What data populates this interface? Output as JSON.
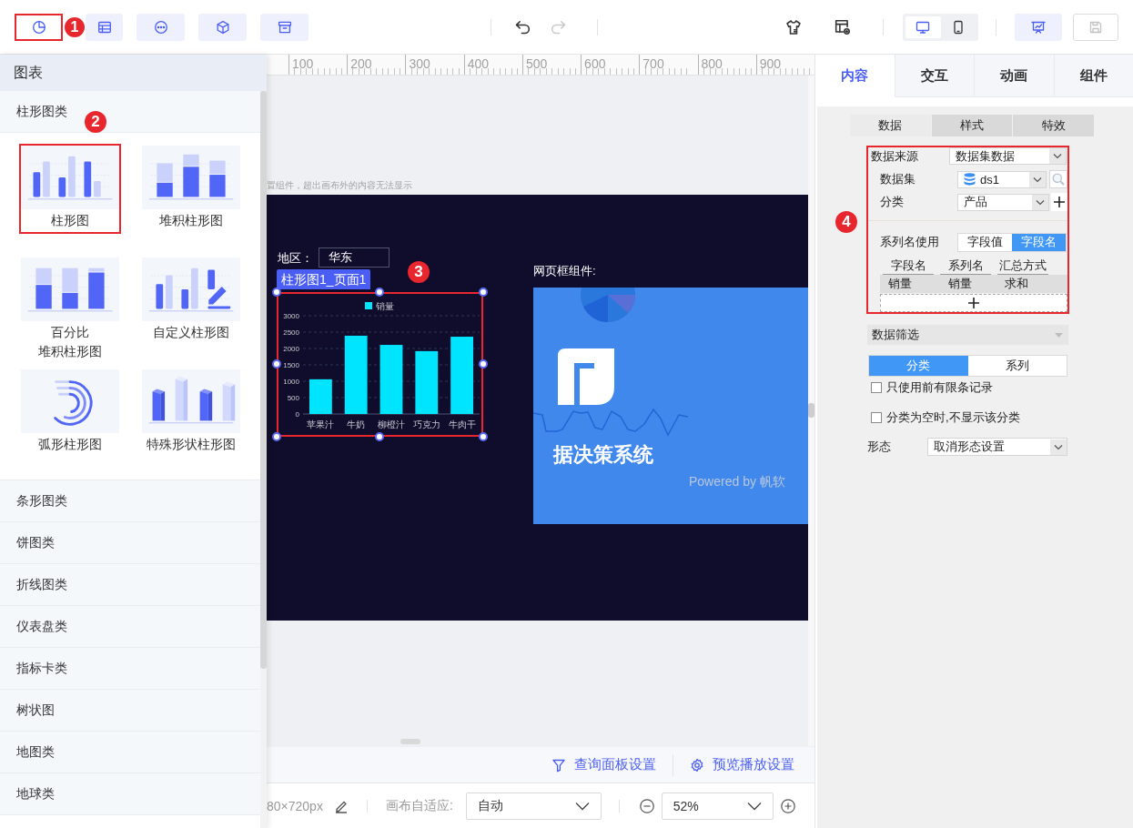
{
  "toolbar": {
    "left_buttons": [
      {
        "kind": "chart",
        "highlighted": true,
        "callout": "1"
      },
      {
        "kind": "table",
        "highlighted": false
      },
      {
        "kind": "more",
        "highlighted": false
      },
      {
        "kind": "cube",
        "highlighted": false
      },
      {
        "kind": "archive",
        "highlighted": false
      }
    ],
    "history": [
      {
        "kind": "undo",
        "disabled": false
      },
      {
        "kind": "redo",
        "disabled": true
      }
    ],
    "tools": [
      {
        "kind": "theme"
      },
      {
        "kind": "template"
      }
    ],
    "devices": [
      {
        "kind": "desktop",
        "selected": true
      },
      {
        "kind": "mobile",
        "selected": false
      }
    ],
    "actions": [
      {
        "kind": "present",
        "disabled": false
      },
      {
        "kind": "save",
        "disabled": true
      }
    ]
  },
  "component_panel": {
    "title": "图表",
    "groups": [
      {
        "label": "柱形图类",
        "items": [
          {
            "kind": "bar",
            "label_lines": [
              "柱形图"
            ],
            "highlighted": true,
            "callout": "2"
          },
          {
            "kind": "stacked",
            "label_lines": [
              "堆积柱形图"
            ],
            "highlighted": false
          },
          {
            "kind": "percent",
            "label_lines": [
              "百分比",
              "堆积柱形图"
            ],
            "highlighted": false
          },
          {
            "kind": "custom",
            "label_lines": [
              "自定义柱形图"
            ],
            "highlighted": false
          },
          {
            "kind": "arc",
            "label_lines": [
              "弧形柱形图"
            ],
            "highlighted": false
          },
          {
            "kind": "shaped",
            "label_lines": [
              "特殊形状柱形图"
            ],
            "highlighted": false
          }
        ]
      },
      {
        "label": "条形图类"
      },
      {
        "label": "饼图类"
      },
      {
        "label": "折线图类"
      },
      {
        "label": "仪表盘类"
      },
      {
        "label": "指标卡类"
      },
      {
        "label": "树状图"
      },
      {
        "label": "地图类"
      },
      {
        "label": "地球类"
      }
    ]
  },
  "canvas": {
    "ruler": [
      "100",
      "200",
      "300",
      "400",
      "500",
      "600",
      "700",
      "800",
      "900"
    ],
    "hint": "置组件，超出画布外的内容无法显示",
    "filter": {
      "label": "地区：",
      "value": "华东"
    },
    "chart_widget": {
      "tag": "柱形图1_页面1",
      "highlighted": true,
      "callout": "3",
      "chart_data": {
        "type": "bar",
        "categories": [
          "苹果汁",
          "牛奶",
          "柳橙汁",
          "巧克力",
          "牛肉干"
        ],
        "series": [
          {
            "name": "销量",
            "color": "#00e5ff",
            "values": [
              1060,
              2390,
              2110,
              1920,
              2360
            ]
          }
        ],
        "ylim": [
          0,
          3000
        ],
        "yticks": [
          0,
          500,
          1000,
          1500,
          2000,
          2500,
          3000
        ],
        "grid": true
      }
    },
    "web_frame": {
      "label": "网页框组件:",
      "title": "据决策系统",
      "footer": "Powered by 帆软"
    }
  },
  "canvas_footer": {
    "links": [
      {
        "kind": "filter",
        "label": "查询面板设置"
      },
      {
        "kind": "settings",
        "label": "预览播放设置"
      }
    ]
  },
  "status_bar": {
    "size": "80×720px",
    "fit_label": "画布自适应:",
    "fit_value": "自动",
    "zoom": "52%"
  },
  "properties": {
    "tabs": [
      {
        "label": "内容",
        "selected": true
      },
      {
        "label": "交互",
        "selected": false
      },
      {
        "label": "动画",
        "selected": false
      },
      {
        "label": "组件",
        "selected": false
      }
    ],
    "subtabs": [
      {
        "label": "数据",
        "selected": true
      },
      {
        "label": "样式",
        "selected": false
      },
      {
        "label": "特效",
        "selected": false
      }
    ],
    "data_section": {
      "highlighted": true,
      "callout": "4",
      "source": {
        "label": "数据来源",
        "value": "数据集数据"
      },
      "dataset": {
        "label": "数据集",
        "value": "ds1"
      },
      "category": {
        "label": "分类",
        "value": "产品"
      },
      "series_name": {
        "label": "系列名使用",
        "options": [
          {
            "label": "字段值",
            "selected": false
          },
          {
            "label": "字段名",
            "selected": true
          }
        ]
      },
      "fields_table": {
        "columns": [
          "字段名",
          "系列名",
          "汇总方式"
        ],
        "rows": [
          [
            "销量",
            "销量",
            "求和"
          ]
        ]
      }
    },
    "filter_section": {
      "title": "数据筛选",
      "tabs": [
        {
          "label": "分类",
          "selected": true
        },
        {
          "label": "系列",
          "selected": false
        }
      ],
      "options": [
        {
          "label": "只使用前有限条记录",
          "checked": false
        },
        {
          "label": "分类为空时,不显示该分类",
          "checked": false
        }
      ]
    },
    "form": {
      "label": "形态",
      "value": "取消形态设置"
    }
  }
}
